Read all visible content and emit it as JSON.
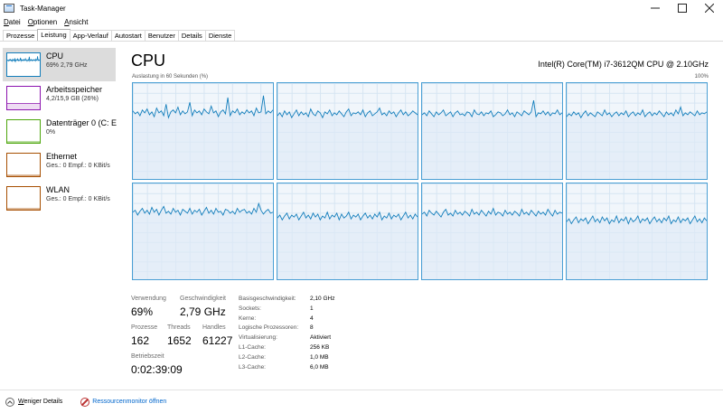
{
  "window": {
    "title": "Task-Manager"
  },
  "menu": [
    "Datei",
    "Optionen",
    "Ansicht"
  ],
  "menu_access_keys": [
    "D",
    "O",
    "A"
  ],
  "tabs": [
    "Prozesse",
    "Leistung",
    "App-Verlauf",
    "Autostart",
    "Benutzer",
    "Details",
    "Dienste"
  ],
  "active_tab": "Leistung",
  "sidebar": [
    {
      "name": "CPU",
      "sub": "69% 2,79 GHz",
      "color": "#117dbb"
    },
    {
      "name": "Arbeitsspeicher",
      "sub": "4,2/15,9 GB (26%)",
      "color": "#8b12ae"
    },
    {
      "name": "Datenträger 0 (C: E",
      "sub": "0%",
      "color": "#4da60c"
    },
    {
      "name": "Ethernet",
      "sub": "Ges.: 0 Empf.: 0 KBit/s",
      "color": "#a74f01"
    },
    {
      "name": "WLAN",
      "sub": "Ges.: 0 Empf.: 0 KBit/s",
      "color": "#a74f01"
    }
  ],
  "main": {
    "title": "CPU",
    "model": "Intel(R) Core(TM) i7-3612QM CPU @ 2.10GHz",
    "axis_label": "Auslastung in 60 Sekunden (%)",
    "axis_max": "100%"
  },
  "stats": {
    "usage_label": "Verwendung",
    "usage": "69%",
    "speed_label": "Geschwindigkeit",
    "speed": "2,79 GHz",
    "processes_label": "Prozesse",
    "processes": "162",
    "threads_label": "Threads",
    "threads": "1652",
    "handles_label": "Handles",
    "handles": "61227",
    "uptime_label": "Betriebszeit",
    "uptime": "0:02:39:09"
  },
  "info": [
    {
      "key": "Basisgeschwindigkeit:",
      "value": "2,10 GHz"
    },
    {
      "key": "Sockets:",
      "value": "1"
    },
    {
      "key": "Kerne:",
      "value": "4"
    },
    {
      "key": "Logische Prozessoren:",
      "value": "8"
    },
    {
      "key": "Virtualisierung:",
      "value": "Aktiviert"
    },
    {
      "key": "L1-Cache:",
      "value": "256 KB"
    },
    {
      "key": "L2-Cache:",
      "value": "1,0 MB"
    },
    {
      "key": "L3-Cache:",
      "value": "6,0 MB"
    }
  ],
  "footer": {
    "less_details": "Weniger Details",
    "less_details_key": "W",
    "resource_monitor": "Ressourcenmonitor öffnen"
  },
  "colors": {
    "cpu_line": "#117dbb",
    "grid_border": "#4a9fd4"
  },
  "chart_data": {
    "type": "line",
    "ylim": [
      0,
      100
    ],
    "series": [
      {
        "values": [
          71,
          68,
          70,
          66,
          72,
          69,
          73,
          67,
          70,
          65,
          74,
          69,
          71,
          66,
          78,
          64,
          70,
          72,
          69,
          75,
          67,
          71,
          68,
          70,
          80,
          66,
          72,
          69,
          71,
          67,
          73,
          70,
          68,
          76,
          69,
          71,
          65,
          70,
          72,
          68,
          85,
          66,
          71,
          69,
          73,
          67,
          70,
          68,
          72,
          69,
          71,
          66,
          74,
          69,
          70,
          87,
          68,
          71,
          69,
          72
        ]
      },
      {
        "values": [
          66,
          69,
          65,
          71,
          67,
          70,
          64,
          68,
          72,
          66,
          70,
          67,
          69,
          65,
          73,
          68,
          66,
          71,
          69,
          64,
          70,
          68,
          72,
          66,
          69,
          67,
          71,
          68,
          65,
          70,
          73,
          66,
          69,
          68,
          70,
          67,
          72,
          65,
          69,
          71,
          66,
          68,
          70,
          74,
          67,
          69,
          66,
          71,
          68,
          70,
          65,
          69,
          72,
          67,
          70,
          66,
          68,
          71,
          69,
          67
        ]
      },
      {
        "values": [
          67,
          69,
          66,
          71,
          68,
          65,
          70,
          67,
          69,
          72,
          66,
          68,
          70,
          65,
          69,
          71,
          67,
          68,
          66,
          70,
          69,
          65,
          72,
          68,
          67,
          70,
          66,
          69,
          68,
          71,
          65,
          67,
          70,
          69,
          66,
          68,
          72,
          67,
          69,
          65,
          70,
          68,
          66,
          71,
          69,
          67,
          70,
          82,
          65,
          69,
          68,
          71,
          67,
          70,
          66,
          69,
          68,
          72,
          67,
          69
        ]
      },
      {
        "values": [
          65,
          68,
          66,
          70,
          67,
          69,
          64,
          68,
          71,
          66,
          69,
          67,
          65,
          70,
          68,
          66,
          72,
          67,
          69,
          65,
          68,
          70,
          66,
          69,
          67,
          71,
          65,
          68,
          70,
          66,
          69,
          67,
          72,
          65,
          68,
          70,
          66,
          69,
          67,
          71,
          68,
          65,
          70,
          67,
          69,
          66,
          72,
          68,
          75,
          66,
          69,
          67,
          70,
          68,
          66,
          71,
          67,
          69,
          68,
          70
        ]
      },
      {
        "values": [
          70,
          72,
          67,
          71,
          74,
          69,
          72,
          68,
          75,
          70,
          73,
          67,
          72,
          76,
          69,
          71,
          68,
          74,
          70,
          72,
          67,
          73,
          71,
          69,
          74,
          68,
          72,
          70,
          73,
          67,
          71,
          75,
          69,
          72,
          68,
          74,
          70,
          71,
          67,
          73,
          72,
          69,
          71,
          68,
          74,
          70,
          72,
          73,
          69,
          71,
          68,
          74,
          70,
          79,
          72,
          68,
          71,
          73,
          69,
          70
        ]
      },
      {
        "values": [
          64,
          67,
          62,
          66,
          69,
          63,
          67,
          65,
          68,
          62,
          66,
          70,
          64,
          67,
          63,
          69,
          65,
          68,
          62,
          66,
          64,
          70,
          63,
          67,
          65,
          69,
          62,
          68,
          64,
          66,
          70,
          63,
          67,
          65,
          68,
          62,
          66,
          69,
          64,
          67,
          63,
          68,
          65,
          70,
          62,
          66,
          64,
          69,
          63,
          67,
          65,
          68,
          62,
          66,
          70,
          64,
          67,
          63,
          68,
          65
        ]
      },
      {
        "values": [
          68,
          70,
          66,
          72,
          69,
          67,
          71,
          68,
          65,
          70,
          73,
          67,
          69,
          66,
          72,
          68,
          70,
          67,
          71,
          69,
          66,
          73,
          68,
          70,
          67,
          72,
          69,
          66,
          71,
          68,
          74,
          67,
          70,
          69,
          66,
          72,
          68,
          70,
          67,
          71,
          69,
          66,
          73,
          68,
          70,
          67,
          72,
          69,
          66,
          71,
          68,
          70,
          67,
          73,
          69,
          66,
          72,
          68,
          70,
          69
        ]
      },
      {
        "values": [
          60,
          63,
          58,
          62,
          65,
          59,
          63,
          61,
          64,
          58,
          62,
          66,
          60,
          63,
          59,
          65,
          61,
          64,
          58,
          62,
          60,
          66,
          59,
          63,
          61,
          65,
          58,
          64,
          60,
          62,
          66,
          59,
          63,
          61,
          64,
          58,
          62,
          65,
          60,
          63,
          59,
          64,
          61,
          66,
          58,
          62,
          60,
          65,
          59,
          63,
          61,
          64,
          58,
          62,
          66,
          60,
          63,
          59,
          64,
          61
        ]
      }
    ]
  }
}
